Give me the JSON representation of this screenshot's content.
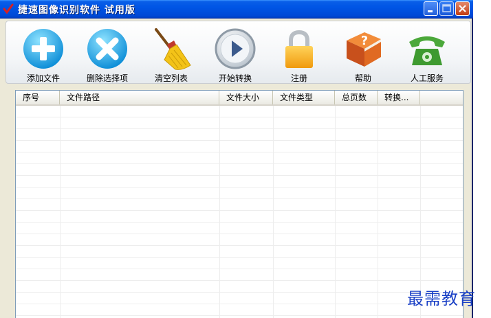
{
  "window": {
    "title": "捷速图像识别软件  试用版"
  },
  "toolbar": {
    "items": [
      {
        "label": "添加文件",
        "icon": "add-circle-icon"
      },
      {
        "label": "删除选择项",
        "icon": "delete-x-circle-icon"
      },
      {
        "label": "清空列表",
        "icon": "broom-icon"
      },
      {
        "label": "开始转换",
        "icon": "play-icon"
      },
      {
        "label": "注册",
        "icon": "lock-icon"
      },
      {
        "label": "帮助",
        "icon": "help-book-icon"
      },
      {
        "label": "人工服务",
        "icon": "telephone-icon"
      }
    ]
  },
  "list": {
    "columns": [
      "序号",
      "文件路径",
      "文件大小",
      "文件类型",
      "总页数",
      "转换..."
    ]
  },
  "watermark": "最需教育",
  "colors": {
    "titlebar": "#0055E5",
    "window_bg": "#ECE9D8",
    "watermark": "#1A40C6"
  }
}
